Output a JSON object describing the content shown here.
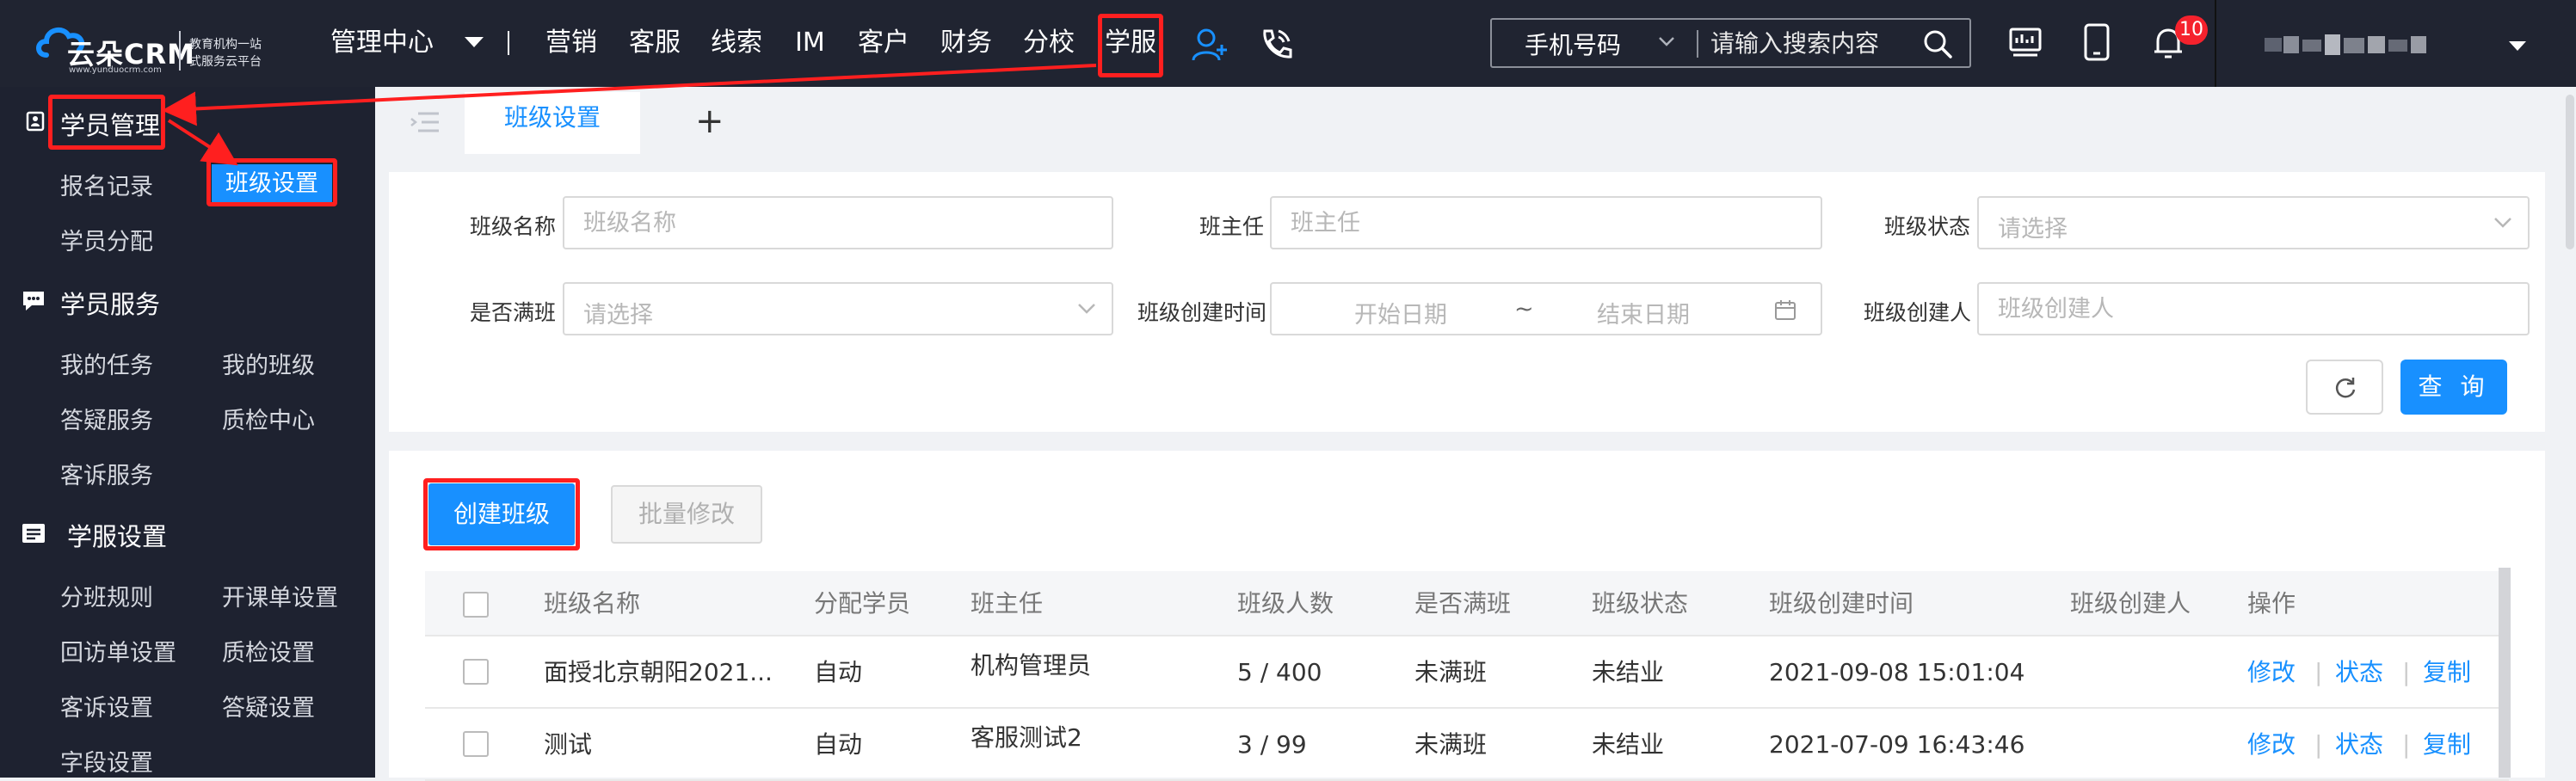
{
  "brand": {
    "name": "云朵CRM",
    "url": "www.yunduocrm.com",
    "tagline_1": "教育机构一站",
    "tagline_2": "式服务云平台"
  },
  "nav": {
    "management": "管理中心",
    "items": [
      "营销",
      "客服",
      "线索",
      "IM",
      "客户",
      "财务",
      "分校",
      "学服"
    ],
    "active": "学服"
  },
  "search": {
    "type": "手机号码",
    "placeholder": "请输入搜索内容"
  },
  "notifications": {
    "count": "10"
  },
  "sidebar": {
    "groups": [
      {
        "title": "学员管理",
        "items": [
          "报名记录",
          "班级设置",
          "学员分配"
        ]
      },
      {
        "title": "学员服务",
        "items": [
          "我的任务",
          "我的班级",
          "答疑服务",
          "质检中心",
          "客诉服务"
        ]
      },
      {
        "title": "学服设置",
        "items": [
          "分班规则",
          "开课单设置",
          "回访单设置",
          "质检设置",
          "客诉设置",
          "答疑设置",
          "字段设置"
        ]
      }
    ],
    "active_item": "班级设置"
  },
  "tabs": {
    "active": "班级设置",
    "add": "+"
  },
  "filters": {
    "class_name": {
      "label": "班级名称",
      "placeholder": "班级名称"
    },
    "head_teacher": {
      "label": "班主任",
      "placeholder": "班主任"
    },
    "class_status": {
      "label": "班级状态",
      "placeholder": "请选择"
    },
    "is_full": {
      "label": "是否满班",
      "placeholder": "请选择"
    },
    "created_time": {
      "label": "班级创建时间",
      "start": "开始日期",
      "sep": "~",
      "end": "结束日期"
    },
    "creator": {
      "label": "班级创建人",
      "placeholder": "班级创建人"
    },
    "query_label": "查 询"
  },
  "actions": {
    "create": "创建班级",
    "batch_edit": "批量修改"
  },
  "table": {
    "columns": [
      "班级名称",
      "分配学员",
      "班主任",
      "班级人数",
      "是否满班",
      "班级状态",
      "班级创建时间",
      "班级创建人",
      "操作"
    ],
    "rows": [
      {
        "name": "面授北京朝阳2021...",
        "assign": "自动",
        "teacher": "机构管理员",
        "count": "5 / 400",
        "full": "未满班",
        "status": "未结业",
        "created": "2021-09-08 15:01:04",
        "creator": ""
      },
      {
        "name": "测试",
        "assign": "自动",
        "teacher": "客服测试2",
        "count": "3 / 99",
        "full": "未满班",
        "status": "未结业",
        "created": "2021-07-09 16:43:46",
        "creator": ""
      }
    ],
    "ops": [
      "修改",
      "状态",
      "复制"
    ],
    "op_sep": "|"
  },
  "colors": {
    "accent": "#1890ff",
    "highlight": "#ff1f1f",
    "topbar": "#202431",
    "sidebar": "#1e2230"
  }
}
